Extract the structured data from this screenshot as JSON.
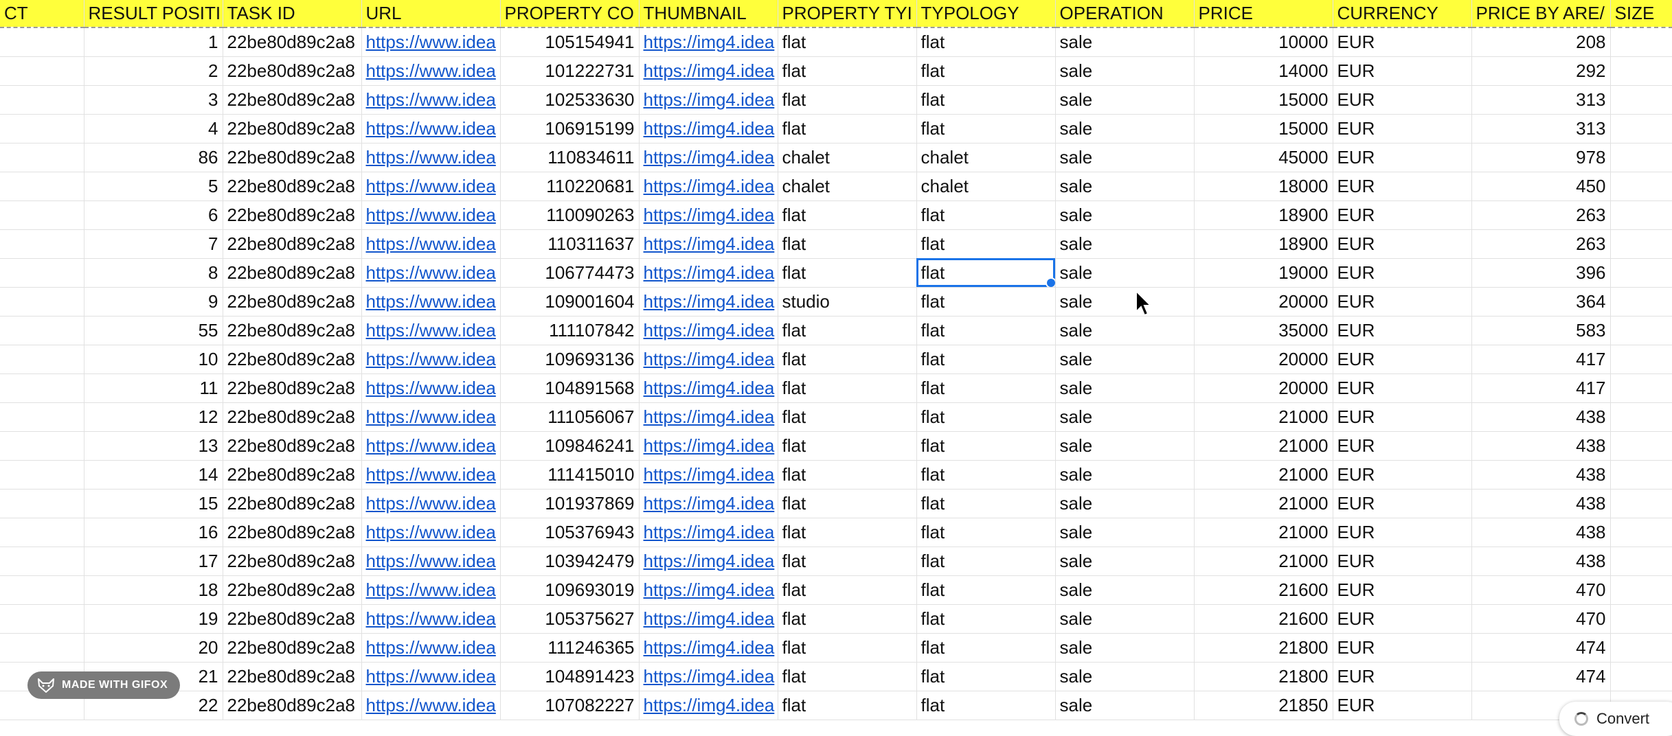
{
  "columns": [
    {
      "label": "CT"
    },
    {
      "label": "RESULT POSITI"
    },
    {
      "label": "TASK ID"
    },
    {
      "label": "URL"
    },
    {
      "label": "PROPERTY CO"
    },
    {
      "label": "THUMBNAIL"
    },
    {
      "label": "PROPERTY TYI"
    },
    {
      "label": "TYPOLOGY"
    },
    {
      "label": "OPERATION"
    },
    {
      "label": "PRICE"
    },
    {
      "label": "CURRENCY"
    },
    {
      "label": "PRICE BY ARE/"
    },
    {
      "label": "SIZE"
    }
  ],
  "rows": [
    {
      "pos": "1",
      "task": "22be80d89c2a8",
      "url": "https://www.idea",
      "code": "105154941",
      "thumb": "https://img4.idea",
      "ptype": "flat",
      "typology": "flat",
      "op": "sale",
      "price": "10000",
      "cur": "EUR",
      "pba": "208"
    },
    {
      "pos": "2",
      "task": "22be80d89c2a8",
      "url": "https://www.idea",
      "code": "101222731",
      "thumb": "https://img4.idea",
      "ptype": "flat",
      "typology": "flat",
      "op": "sale",
      "price": "14000",
      "cur": "EUR",
      "pba": "292"
    },
    {
      "pos": "3",
      "task": "22be80d89c2a8",
      "url": "https://www.idea",
      "code": "102533630",
      "thumb": "https://img4.idea",
      "ptype": "flat",
      "typology": "flat",
      "op": "sale",
      "price": "15000",
      "cur": "EUR",
      "pba": "313"
    },
    {
      "pos": "4",
      "task": "22be80d89c2a8",
      "url": "https://www.idea",
      "code": "106915199",
      "thumb": "https://img4.idea",
      "ptype": "flat",
      "typology": "flat",
      "op": "sale",
      "price": "15000",
      "cur": "EUR",
      "pba": "313"
    },
    {
      "pos": "86",
      "task": "22be80d89c2a8",
      "url": "https://www.idea",
      "code": "110834611",
      "thumb": "https://img4.idea",
      "ptype": "chalet",
      "typology": "chalet",
      "op": "sale",
      "price": "45000",
      "cur": "EUR",
      "pba": "978"
    },
    {
      "pos": "5",
      "task": "22be80d89c2a8",
      "url": "https://www.idea",
      "code": "110220681",
      "thumb": "https://img4.idea",
      "ptype": "chalet",
      "typology": "chalet",
      "op": "sale",
      "price": "18000",
      "cur": "EUR",
      "pba": "450"
    },
    {
      "pos": "6",
      "task": "22be80d89c2a8",
      "url": "https://www.idea",
      "code": "110090263",
      "thumb": "https://img4.idea",
      "ptype": "flat",
      "typology": "flat",
      "op": "sale",
      "price": "18900",
      "cur": "EUR",
      "pba": "263"
    },
    {
      "pos": "7",
      "task": "22be80d89c2a8",
      "url": "https://www.idea",
      "code": "110311637",
      "thumb": "https://img4.idea",
      "ptype": "flat",
      "typology": "flat",
      "op": "sale",
      "price": "18900",
      "cur": "EUR",
      "pba": "263"
    },
    {
      "pos": "8",
      "task": "22be80d89c2a8",
      "url": "https://www.idea",
      "code": "106774473",
      "thumb": "https://img4.idea",
      "ptype": "flat",
      "typology": "flat",
      "op": "sale",
      "price": "19000",
      "cur": "EUR",
      "pba": "396",
      "selected": true
    },
    {
      "pos": "9",
      "task": "22be80d89c2a8",
      "url": "https://www.idea",
      "code": "109001604",
      "thumb": "https://img4.idea",
      "ptype": "studio",
      "typology": "flat",
      "op": "sale",
      "price": "20000",
      "cur": "EUR",
      "pba": "364"
    },
    {
      "pos": "55",
      "task": "22be80d89c2a8",
      "url": "https://www.idea",
      "code": "111107842",
      "thumb": "https://img4.idea",
      "ptype": "flat",
      "typology": "flat",
      "op": "sale",
      "price": "35000",
      "cur": "EUR",
      "pba": "583"
    },
    {
      "pos": "10",
      "task": "22be80d89c2a8",
      "url": "https://www.idea",
      "code": "109693136",
      "thumb": "https://img4.idea",
      "ptype": "flat",
      "typology": "flat",
      "op": "sale",
      "price": "20000",
      "cur": "EUR",
      "pba": "417"
    },
    {
      "pos": "11",
      "task": "22be80d89c2a8",
      "url": "https://www.idea",
      "code": "104891568",
      "thumb": "https://img4.idea",
      "ptype": "flat",
      "typology": "flat",
      "op": "sale",
      "price": "20000",
      "cur": "EUR",
      "pba": "417"
    },
    {
      "pos": "12",
      "task": "22be80d89c2a8",
      "url": "https://www.idea",
      "code": "111056067",
      "thumb": "https://img4.idea",
      "ptype": "flat",
      "typology": "flat",
      "op": "sale",
      "price": "21000",
      "cur": "EUR",
      "pba": "438"
    },
    {
      "pos": "13",
      "task": "22be80d89c2a8",
      "url": "https://www.idea",
      "code": "109846241",
      "thumb": "https://img4.idea",
      "ptype": "flat",
      "typology": "flat",
      "op": "sale",
      "price": "21000",
      "cur": "EUR",
      "pba": "438"
    },
    {
      "pos": "14",
      "task": "22be80d89c2a8",
      "url": "https://www.idea",
      "code": "111415010",
      "thumb": "https://img4.idea",
      "ptype": "flat",
      "typology": "flat",
      "op": "sale",
      "price": "21000",
      "cur": "EUR",
      "pba": "438"
    },
    {
      "pos": "15",
      "task": "22be80d89c2a8",
      "url": "https://www.idea",
      "code": "101937869",
      "thumb": "https://img4.idea",
      "ptype": "flat",
      "typology": "flat",
      "op": "sale",
      "price": "21000",
      "cur": "EUR",
      "pba": "438"
    },
    {
      "pos": "16",
      "task": "22be80d89c2a8",
      "url": "https://www.idea",
      "code": "105376943",
      "thumb": "https://img4.idea",
      "ptype": "flat",
      "typology": "flat",
      "op": "sale",
      "price": "21000",
      "cur": "EUR",
      "pba": "438"
    },
    {
      "pos": "17",
      "task": "22be80d89c2a8",
      "url": "https://www.idea",
      "code": "103942479",
      "thumb": "https://img4.idea",
      "ptype": "flat",
      "typology": "flat",
      "op": "sale",
      "price": "21000",
      "cur": "EUR",
      "pba": "438"
    },
    {
      "pos": "18",
      "task": "22be80d89c2a8",
      "url": "https://www.idea",
      "code": "109693019",
      "thumb": "https://img4.idea",
      "ptype": "flat",
      "typology": "flat",
      "op": "sale",
      "price": "21600",
      "cur": "EUR",
      "pba": "470"
    },
    {
      "pos": "19",
      "task": "22be80d89c2a8",
      "url": "https://www.idea",
      "code": "105375627",
      "thumb": "https://img4.idea",
      "ptype": "flat",
      "typology": "flat",
      "op": "sale",
      "price": "21600",
      "cur": "EUR",
      "pba": "470"
    },
    {
      "pos": "20",
      "task": "22be80d89c2a8",
      "url": "https://www.idea",
      "code": "111246365",
      "thumb": "https://img4.idea",
      "ptype": "flat",
      "typology": "flat",
      "op": "sale",
      "price": "21800",
      "cur": "EUR",
      "pba": "474"
    },
    {
      "pos": "21",
      "task": "22be80d89c2a8",
      "url": "https://www.idea",
      "code": "104891423",
      "thumb": "https://img4.idea",
      "ptype": "flat",
      "typology": "flat",
      "op": "sale",
      "price": "21800",
      "cur": "EUR",
      "pba": "474"
    },
    {
      "pos": "22",
      "task": "22be80d89c2a8",
      "url": "https://www.idea",
      "code": "107082227",
      "thumb": "https://img4.idea",
      "ptype": "flat",
      "typology": "flat",
      "op": "sale",
      "price": "21850",
      "cur": "EUR",
      "pba": ""
    }
  ],
  "badge": {
    "label": "MADE WITH GIFOX",
    "icon": "fox-icon"
  },
  "convert": {
    "label": "Convert"
  },
  "colors": {
    "header_bg": "#ffff3b",
    "link": "#1155cc",
    "selection": "#1a73e8",
    "badge_bg": "#7b7b7b"
  }
}
